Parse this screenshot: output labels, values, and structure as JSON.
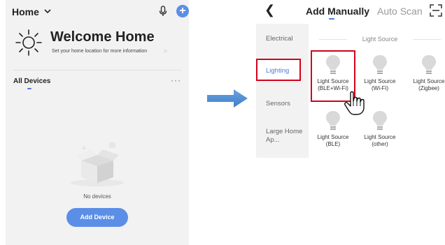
{
  "left_screen": {
    "home_title": "Home",
    "welcome_title": "Welcome Home",
    "welcome_subtitle": "Set your home location for more information",
    "all_devices_label": "All Devices",
    "more_label": "···",
    "empty_text": "No devices",
    "add_device_label": "Add Device",
    "accent_color": "#5b8ee6"
  },
  "right_screen": {
    "tabs": [
      {
        "label": "Add Manually",
        "active": true
      },
      {
        "label": "Auto Scan",
        "active": false
      }
    ],
    "categories": [
      {
        "label": "Electrical",
        "selected": false
      },
      {
        "label": "Lighting",
        "selected": true
      },
      {
        "label": "Sensors",
        "selected": false
      },
      {
        "label": "Large Home Ap...",
        "selected": false
      }
    ],
    "section_title": "Light Source",
    "devices": [
      {
        "line1": "Light Source",
        "line2": "(BLE+Wi-Fi)",
        "highlighted": true
      },
      {
        "line1": "Light Source",
        "line2": "(Wi-Fi)"
      },
      {
        "line1": "Light Source",
        "line2": "(Zigbee)"
      },
      {
        "line1": "Light Source",
        "line2": "(BLE)"
      },
      {
        "line1": "Light Source",
        "line2": "(other)"
      }
    ],
    "highlight_color": "#d0021b",
    "accent_color": "#4a7bdb"
  },
  "icons": [
    "chevron-down-icon",
    "mic-icon",
    "plus-icon",
    "sun-icon",
    "more-icon",
    "empty-box-icon",
    "arrow-right-icon",
    "back-icon",
    "scan-icon",
    "bulb-icon",
    "hand-pointer-icon"
  ]
}
